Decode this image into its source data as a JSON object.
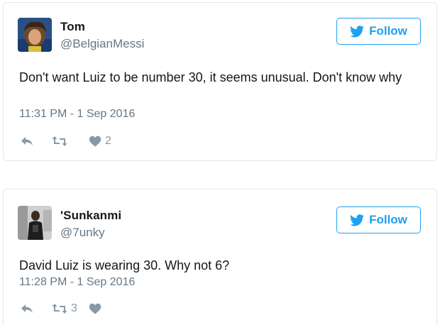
{
  "tweets": [
    {
      "user": {
        "name": "Tom",
        "handle": "@BelgianMessi"
      },
      "follow_label": "Follow",
      "text": "Don't want Luiz to be number 30, it seems unusual. Don't know why",
      "timestamp": "11:31 PM - 1 Sep 2016",
      "actions": {
        "reply_count": "",
        "retweet_count": "",
        "like_count": "2"
      }
    },
    {
      "user": {
        "name": "'Sunkanmi",
        "handle": "@7unky"
      },
      "follow_label": "Follow",
      "text": "David Luiz is wearing 30. Why not 6?",
      "timestamp": "11:28 PM - 1 Sep 2016",
      "actions": {
        "reply_count": "",
        "retweet_count": "3",
        "like_count": ""
      }
    }
  ],
  "icons": {
    "follow": "twitter-bird-icon",
    "reply": "reply-icon",
    "retweet": "retweet-icon",
    "like": "heart-icon"
  },
  "colors": {
    "accent": "#1da1f2",
    "text": "#14171a",
    "muted": "#657786",
    "action": "#8899a6",
    "border": "#e1e8ed"
  }
}
